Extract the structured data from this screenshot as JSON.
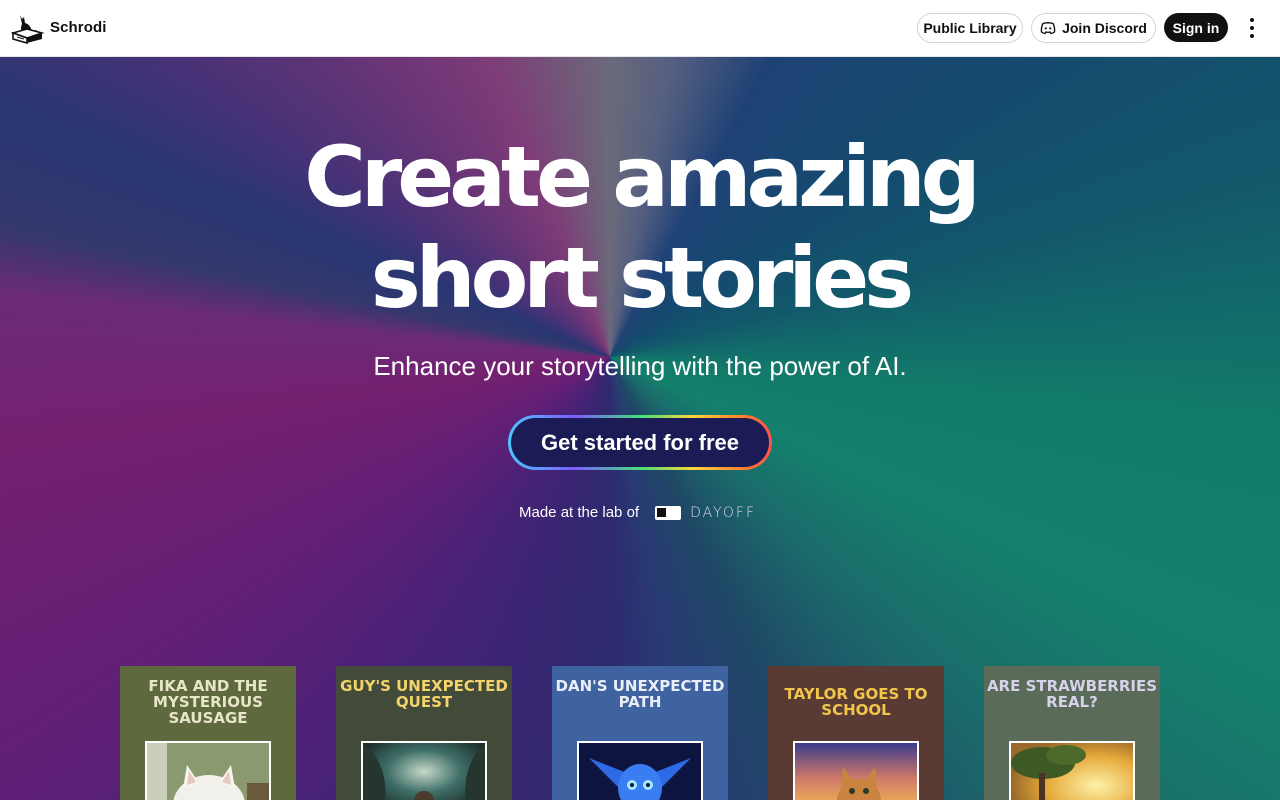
{
  "header": {
    "brand": "Schrodi",
    "public_library": "Public Library",
    "join_discord": "Join Discord",
    "sign_in": "Sign in"
  },
  "hero": {
    "title_line1": "Create amazing",
    "title_line2": "short stories",
    "subtitle": "Enhance your storytelling with the power of AI.",
    "cta": "Get started for free",
    "made_at": "Made at the lab of",
    "lab_name": "DAYOFF"
  },
  "stories": [
    {
      "title": "FIKA AND THE MYSTERIOUS SAUSAGE",
      "bg": "#5e6a3e",
      "title_color": "#e7e6c8",
      "image": "white-cat-photo"
    },
    {
      "title": "GUY'S UNEXPECTED QUEST",
      "bg": "#424a3a",
      "title_color": "#f3d46a",
      "image": "fantasy-forest-scene"
    },
    {
      "title": "DAN'S UNEXPECTED PATH",
      "bg": "#3f62a0",
      "title_color": "#e9eef8",
      "image": "blue-winged-creature"
    },
    {
      "title": "TAYLOR GOES TO SCHOOL",
      "bg": "#593b33",
      "title_color": "#f2c64c",
      "image": "orange-cat-sunset"
    },
    {
      "title": "ARE STRAWBERRIES REAL?",
      "bg": "#5b6b5a",
      "title_color": "#d6d2ea",
      "image": "tree-golden-sky"
    }
  ]
}
